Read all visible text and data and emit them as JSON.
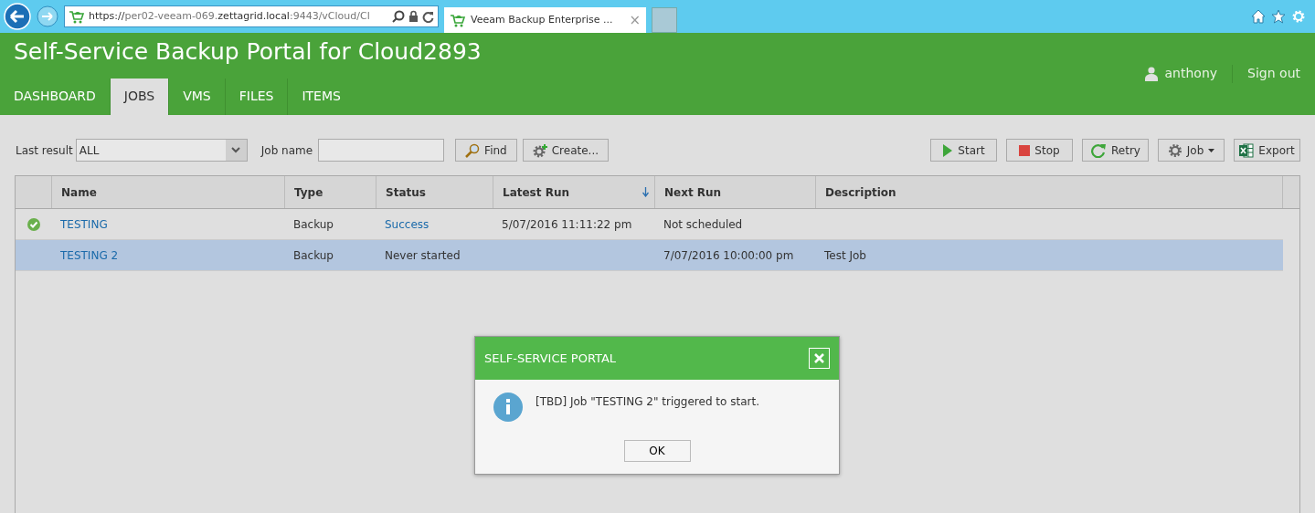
{
  "browser": {
    "url": [
      {
        "text": "https://",
        "dim": false
      },
      {
        "text": "per02-veeam-069.",
        "dim": true
      },
      {
        "text": "zettagrid.local",
        "dim": false
      },
      {
        "text": ":9443/vCloud/Cl",
        "dim": true
      }
    ],
    "tab_title": "Veeam Backup Enterprise ...",
    "close": "×"
  },
  "header": {
    "title": "Self-Service Backup Portal for Cloud2893",
    "user": "anthony",
    "sign_out": "Sign out"
  },
  "nav": [
    {
      "label": "DASHBOARD",
      "selected": false
    },
    {
      "label": "JOBS",
      "selected": true
    },
    {
      "label": "VMS",
      "selected": false
    },
    {
      "label": "FILES",
      "selected": false
    },
    {
      "label": "ITEMS",
      "selected": false
    }
  ],
  "filters": {
    "last_result_label": "Last result",
    "last_result": "ALL",
    "job_name_label": "Job name",
    "find": "Find",
    "create": "Create..."
  },
  "actions": [
    {
      "kind": "start",
      "label": "Start"
    },
    {
      "kind": "stop",
      "label": "Stop"
    },
    {
      "kind": "retry",
      "label": "Retry"
    },
    {
      "kind": "job",
      "label": "Job"
    },
    {
      "kind": "export",
      "label": "Export"
    }
  ],
  "table": {
    "columns": [
      {
        "label": "Name",
        "sorted": false
      },
      {
        "label": "Type",
        "sorted": false
      },
      {
        "label": "Status",
        "sorted": false
      },
      {
        "label": "Latest Run",
        "sorted": true
      },
      {
        "label": "Next Run",
        "sorted": false
      },
      {
        "label": "Description",
        "sorted": false
      }
    ],
    "rows": [
      {
        "success": true,
        "selected": false,
        "name": "TESTING",
        "type": "Backup",
        "status": "Success",
        "status_link": true,
        "latest_run": "5/07/2016 11:11:22 pm",
        "next_run": "Not scheduled"
      },
      {
        "success": false,
        "selected": true,
        "name": "TESTING 2",
        "type": "Backup",
        "status": "Never started",
        "status_link": false,
        "next_run": "7/07/2016 10:00:00 pm",
        "description": "Test Job"
      }
    ]
  },
  "dialog": {
    "title": "SELF-SERVICE PORTAL",
    "message": "[TBD] Job \"TESTING 2\" triggered to start.",
    "ok": "OK"
  }
}
